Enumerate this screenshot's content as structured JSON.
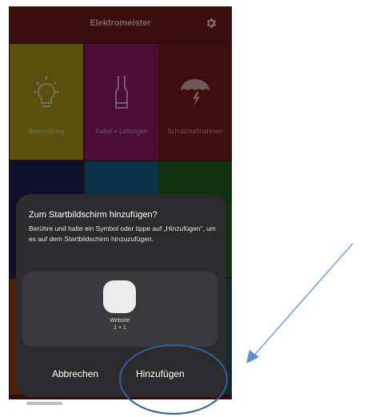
{
  "app": {
    "title": "Elektromeister",
    "settings_icon": "gear-icon"
  },
  "tiles": [
    {
      "label": "Beleuchtung",
      "icon": "lightbulb-icon",
      "color": "#a39319"
    },
    {
      "label": "Kabel + Leitungen",
      "icon": "cable-icon",
      "color": "#8d1a62"
    },
    {
      "label": "Schutzmaßnahmen",
      "icon": "umbrella-lightning-icon",
      "color": "#711b1c"
    },
    {
      "label": "",
      "icon": "",
      "color": "#1d1e4f"
    },
    {
      "label": "",
      "icon": "",
      "color": "#115c80"
    },
    {
      "label": "",
      "icon": "",
      "color": "#205b1e"
    }
  ],
  "dialog": {
    "title": "Zum Startbildschirm hinzufügen?",
    "body": "Berühre und halte ein Symbol oder tippe auf „Hinzufügen“, um es auf dem Startbildschirm hinzuzufügen.",
    "preview": {
      "name": "Website",
      "size": "1 × 1"
    },
    "cancel_label": "Abbrechen",
    "add_label": "Hinzufügen"
  },
  "annotation": {
    "arrow_color": "#5b8fd6",
    "circle_color": "#2f5e9e"
  }
}
